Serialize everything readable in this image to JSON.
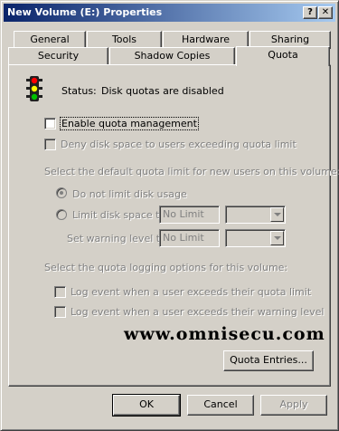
{
  "window": {
    "title": "New Volume (E:) Properties",
    "help_button": "?",
    "close_button": "✕"
  },
  "tabs_row_back": [
    "General",
    "Tools",
    "Hardware",
    "Sharing"
  ],
  "tabs_row_front": [
    "Security",
    "Shadow Copies",
    "Quota"
  ],
  "active_tab": "Quota",
  "quota": {
    "status_label": "Status:",
    "status_value": "Disk quotas are disabled",
    "enable_quota": {
      "label": "Enable quota management",
      "checked": false,
      "enabled": true
    },
    "deny_space": {
      "label": "Deny disk space to users exceeding quota limit",
      "checked": false,
      "enabled": false
    },
    "default_limit_section": "Select the default quota limit for new users on this volume:",
    "no_limit_radio": {
      "label": "Do not limit disk usage",
      "selected": true,
      "enabled": false
    },
    "limit_radio": {
      "label": "Limit disk space to",
      "selected": false,
      "enabled": false
    },
    "limit_value": "No Limit",
    "limit_unit": "",
    "warning_label": "Set warning level to",
    "warning_value": "No Limit",
    "warning_unit": "",
    "logging_section": "Select the quota logging options for this volume:",
    "log_limit": {
      "label": "Log event when a user exceeds their quota limit",
      "checked": false,
      "enabled": false
    },
    "log_warning": {
      "label": "Log event when a user exceeds their warning level",
      "checked": false,
      "enabled": false
    },
    "quota_entries_button": "Quota Entries..."
  },
  "watermark": "www.omnisecu.com",
  "footer": {
    "ok": "OK",
    "cancel": "Cancel",
    "apply": "Apply"
  },
  "icons": {
    "status": "traffic-light-icon",
    "traffic_light_colors": [
      "#ff0000",
      "#ffff00",
      "#00c000"
    ]
  }
}
